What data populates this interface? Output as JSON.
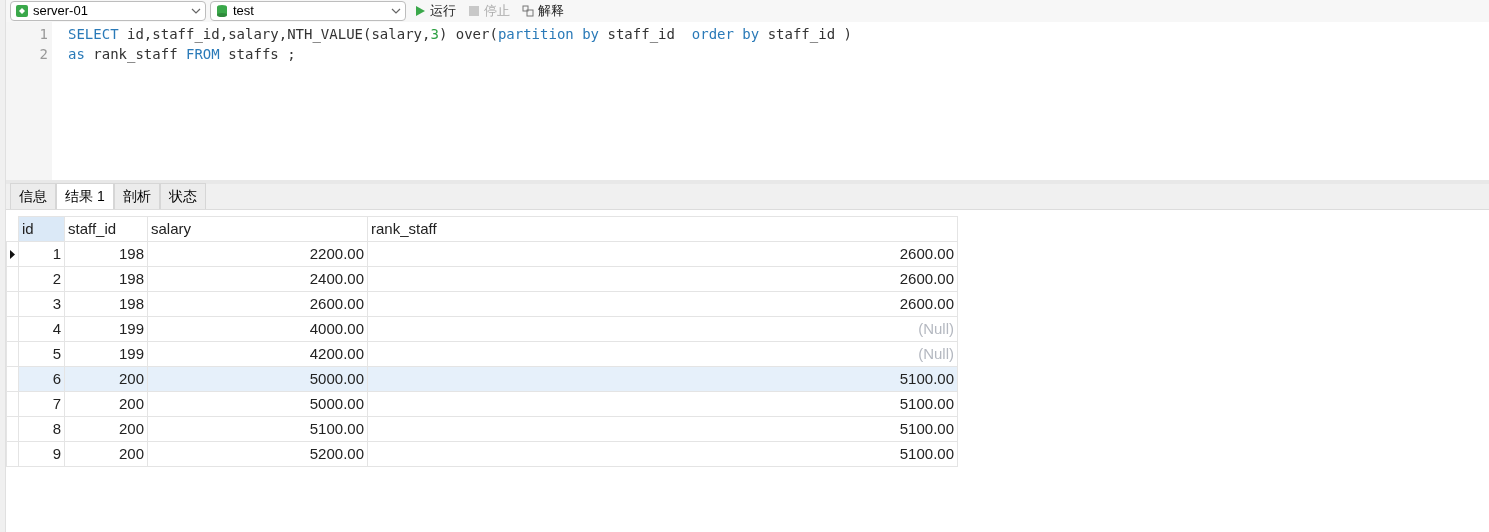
{
  "toolbar": {
    "connection": "server-01",
    "database": "test",
    "buttons": [
      {
        "label": "运行",
        "kind": "run",
        "disabled": false
      },
      {
        "label": "停止",
        "kind": "stop",
        "disabled": true
      },
      {
        "label": "解释",
        "kind": "explain",
        "disabled": false
      }
    ]
  },
  "editor": {
    "lines": [
      {
        "number": "1",
        "tokens": [
          {
            "text": "SELECT",
            "kind": "keyword"
          },
          {
            "text": " id,staff_id,salary,NTH_VALUE(salary,",
            "kind": "plain"
          },
          {
            "text": "3",
            "kind": "number"
          },
          {
            "text": ") over(",
            "kind": "plain"
          },
          {
            "text": "partition by",
            "kind": "keyword"
          },
          {
            "text": " staff_id  ",
            "kind": "plain"
          },
          {
            "text": "order by",
            "kind": "keyword"
          },
          {
            "text": " staff_id )",
            "kind": "plain"
          }
        ]
      },
      {
        "number": "2",
        "tokens": [
          {
            "text": "as",
            "kind": "keyword"
          },
          {
            "text": " rank_staff ",
            "kind": "plain"
          },
          {
            "text": "FROM",
            "kind": "keyword"
          },
          {
            "text": " staffs ;",
            "kind": "plain"
          }
        ]
      }
    ]
  },
  "result_tabs": [
    {
      "label": "信息",
      "selected": false
    },
    {
      "label": "结果 1",
      "selected": true
    },
    {
      "label": "剖析",
      "selected": false
    },
    {
      "label": "状态",
      "selected": false
    }
  ],
  "table": {
    "columns": [
      {
        "label": "id",
        "selected": true
      },
      {
        "label": "staff_id",
        "selected": false
      },
      {
        "label": "salary",
        "selected": false
      },
      {
        "label": "rank_staff",
        "selected": false
      }
    ],
    "rows": [
      {
        "current": true,
        "highlighted": false,
        "cells": [
          "1",
          "198",
          "2200.00",
          "2600.00"
        ],
        "null": false
      },
      {
        "current": false,
        "highlighted": false,
        "cells": [
          "2",
          "198",
          "2400.00",
          "2600.00"
        ],
        "null": false
      },
      {
        "current": false,
        "highlighted": false,
        "cells": [
          "3",
          "198",
          "2600.00",
          "2600.00"
        ],
        "null": false
      },
      {
        "current": false,
        "highlighted": false,
        "cells": [
          "4",
          "199",
          "4000.00",
          "(Null)"
        ],
        "null": true
      },
      {
        "current": false,
        "highlighted": false,
        "cells": [
          "5",
          "199",
          "4200.00",
          "(Null)"
        ],
        "null": true
      },
      {
        "current": false,
        "highlighted": true,
        "cells": [
          "6",
          "200",
          "5000.00",
          "5100.00"
        ],
        "null": false
      },
      {
        "current": false,
        "highlighted": false,
        "cells": [
          "7",
          "200",
          "5000.00",
          "5100.00"
        ],
        "null": false
      },
      {
        "current": false,
        "highlighted": false,
        "cells": [
          "8",
          "200",
          "5100.00",
          "5100.00"
        ],
        "null": false
      },
      {
        "current": false,
        "highlighted": false,
        "cells": [
          "9",
          "200",
          "5200.00",
          "5100.00"
        ],
        "null": false
      }
    ]
  }
}
